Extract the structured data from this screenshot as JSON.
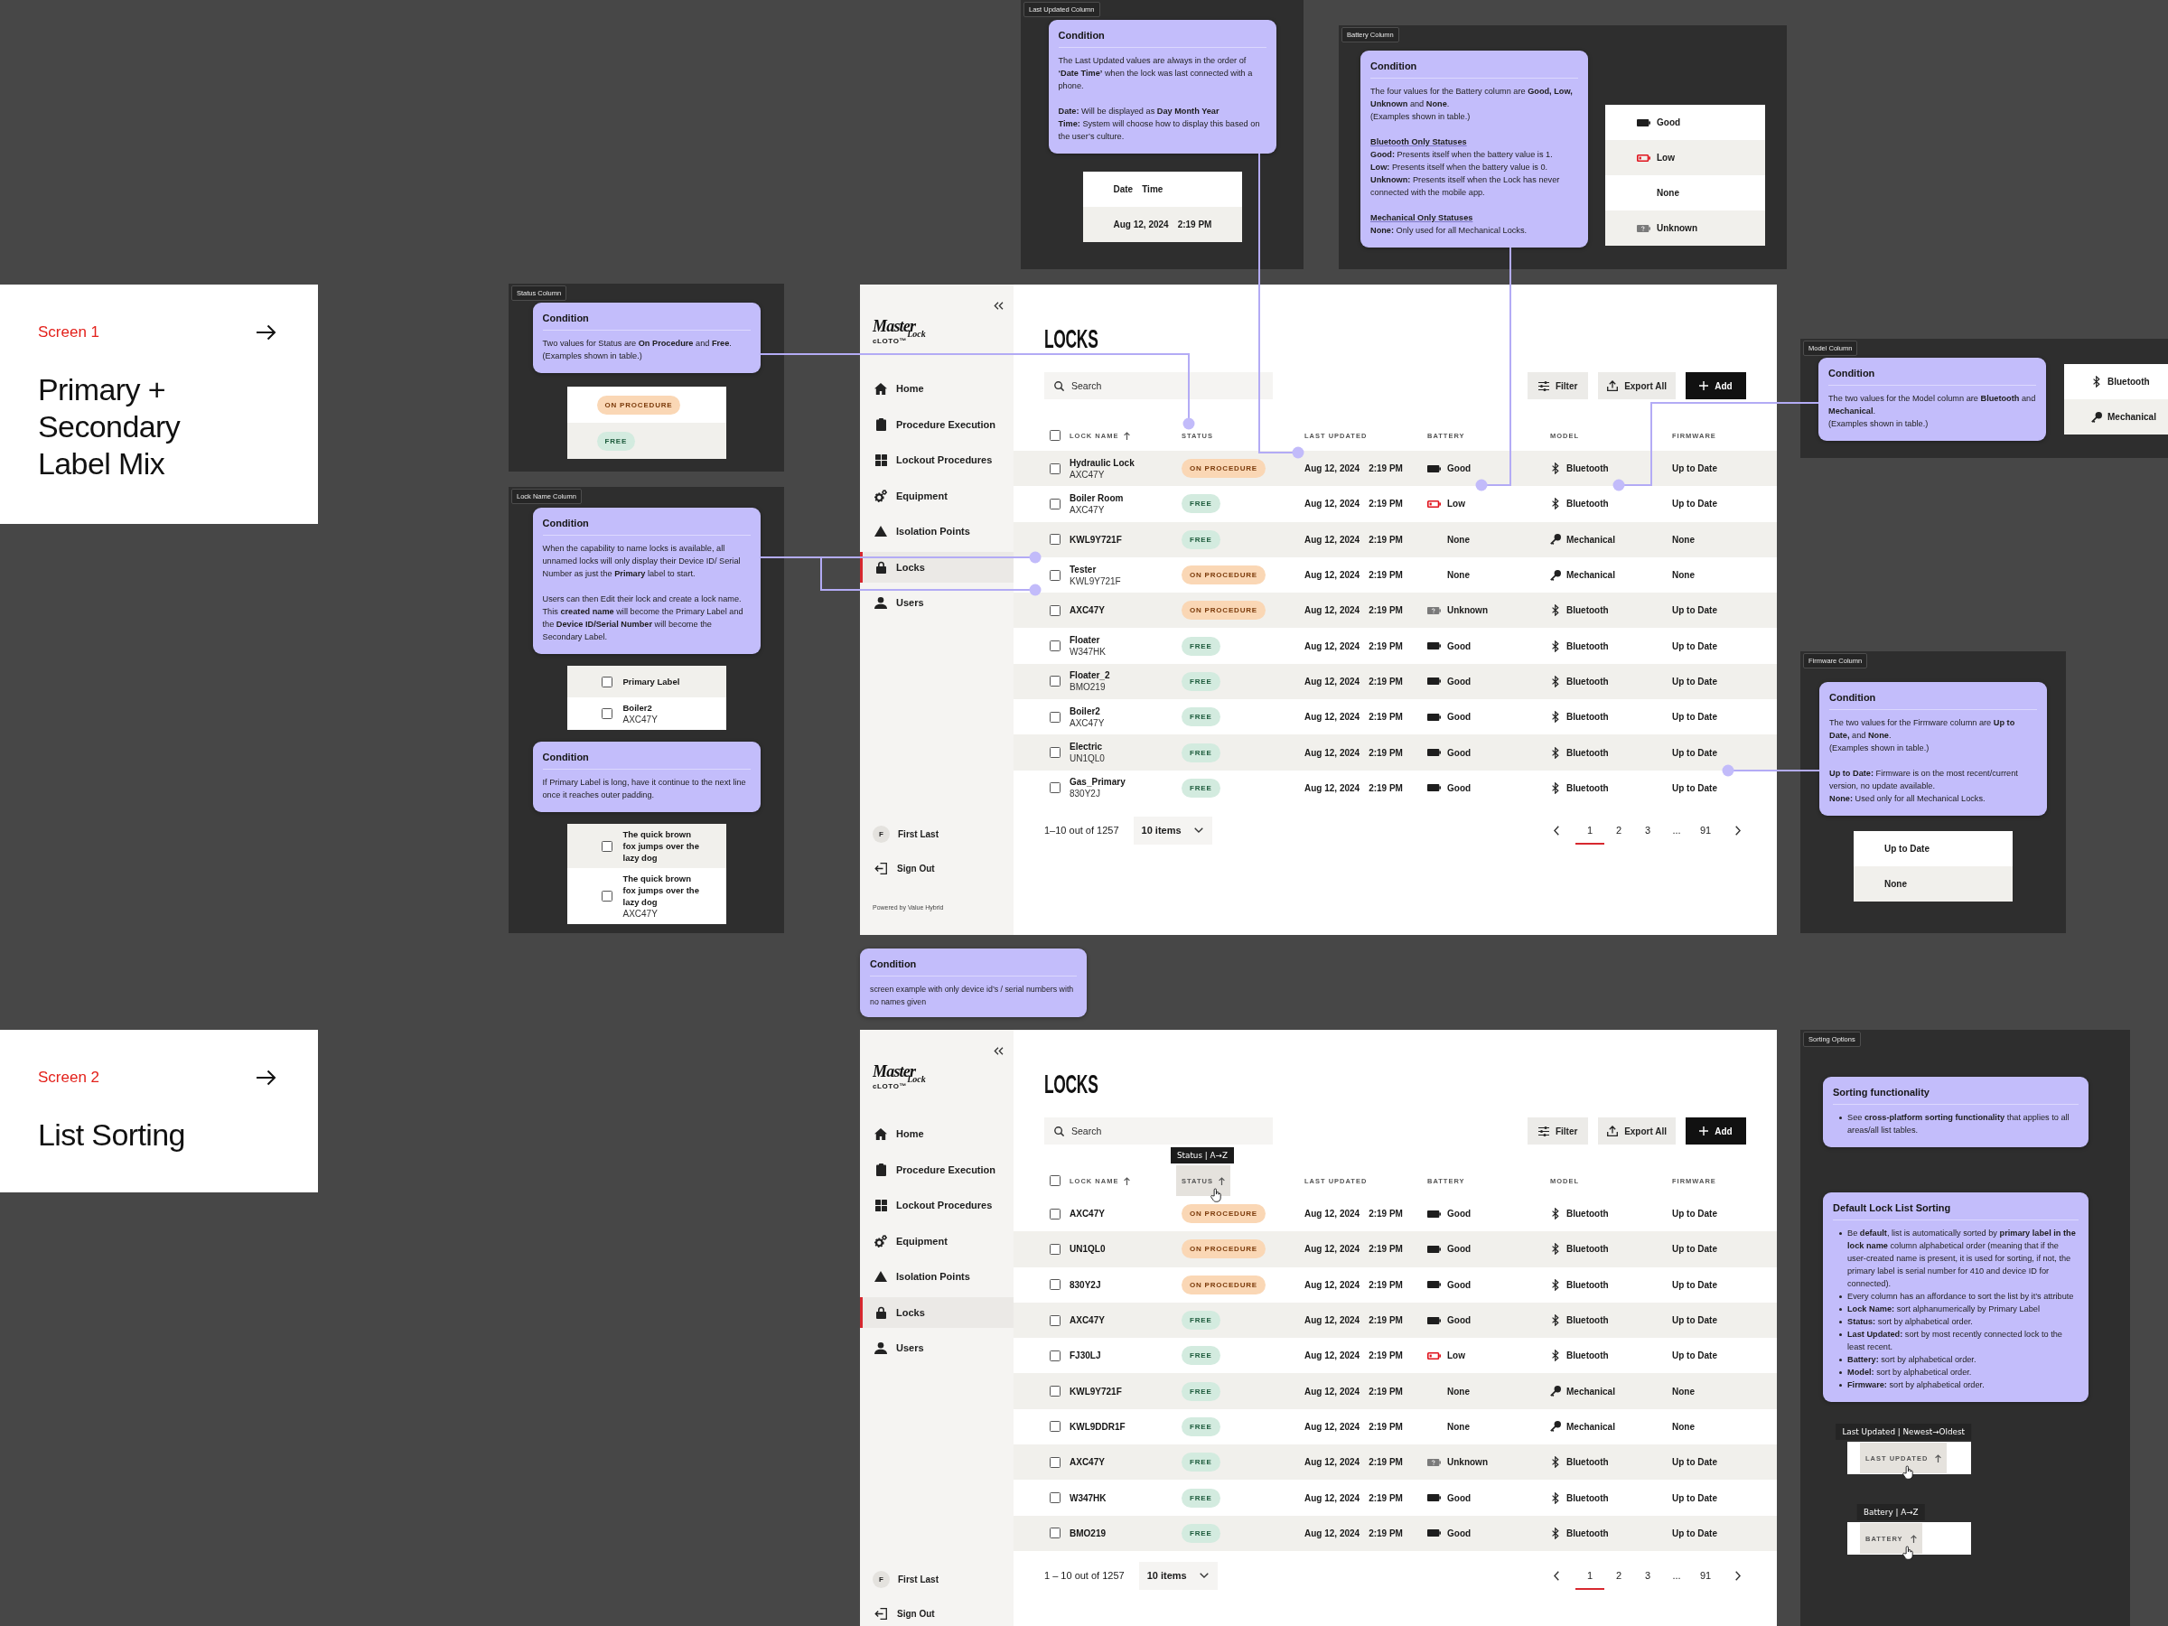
{
  "section_cards": [
    {
      "label": "Screen 1",
      "title": "Primary + Secondary Label Mix"
    },
    {
      "label": "Screen 2",
      "title": "List Sorting"
    }
  ],
  "annotation_panels": [
    {
      "tag": "Last Updated Column",
      "blocks": [
        {
          "kind": "condition",
          "title": "Condition",
          "paragraphs": [
            {
              "lines": [
                "The Last Updated values are always in the order of **‘Date Time’** when the lock was last connected with a phone."
              ]
            },
            {
              "lines": [
                "**Date:** Will be displayed as **Day Month Year**",
                "**Time:** System will choose how to display this based on the user’s culture."
              ]
            }
          ]
        },
        {
          "kind": "example",
          "rows": [
            {
              "kind": "datetime",
              "shaded": false,
              "date": "Date",
              "time": "Time"
            },
            {
              "kind": "datetime",
              "shaded": true,
              "date": "Aug 12, 2024",
              "time": "2:19 PM"
            }
          ]
        }
      ]
    },
    {
      "tag": "Battery Column",
      "blocks": [
        {
          "kind": "condition",
          "title": "Condition",
          "paragraphs": [
            {
              "lines": [
                "The four values for the Battery column are **Good, Low, Unknown** and **None**.",
                "(Examples shown in table.)"
              ]
            },
            {
              "heading": "Bluetooth Only Statuses",
              "lines": [
                "**Good:** Presents itself when the battery value is 1.",
                "**Low:** Presents itself when the battery value is 0.",
                "**Unknown:** Presents itself when the Lock has never connected with the mobile app."
              ]
            },
            {
              "heading": "Mechanical Only Statuses",
              "lines": [
                "**None:** Only used for all Mechanical Locks."
              ]
            }
          ]
        },
        {
          "kind": "example",
          "rows": [
            {
              "kind": "battery",
              "shaded": false,
              "battery": {
                "kind": "good",
                "label": "Good"
              }
            },
            {
              "kind": "battery",
              "shaded": true,
              "battery": {
                "kind": "low",
                "label": "Low"
              }
            },
            {
              "kind": "battery",
              "shaded": false,
              "battery": {
                "kind": "none",
                "label": "None"
              }
            },
            {
              "kind": "battery",
              "shaded": true,
              "battery": {
                "kind": "unknown",
                "label": "Unknown"
              }
            }
          ]
        }
      ]
    },
    {
      "tag": "Status Column",
      "blocks": [
        {
          "kind": "condition",
          "title": "Condition",
          "paragraphs": [
            {
              "lines": [
                "Two values for Status are **On Procedure** and **Free**.",
                "(Examples shown in table.)"
              ]
            }
          ]
        },
        {
          "kind": "example",
          "rows": [
            {
              "kind": "status",
              "shaded": false,
              "status": {
                "kind": "procedure",
                "label": "ON PROCEDURE"
              }
            },
            {
              "kind": "status",
              "shaded": true,
              "status": {
                "kind": "free",
                "label": "FREE"
              }
            }
          ]
        }
      ]
    },
    {
      "tag": "Model Column",
      "blocks": [
        {
          "kind": "condition",
          "title": "Condition",
          "paragraphs": [
            {
              "lines": [
                "The two values for the Model column are **Bluetooth** and **Mechanical**.",
                "(Examples shown in table.)"
              ]
            }
          ]
        },
        {
          "kind": "example",
          "rows": [
            {
              "kind": "model",
              "shaded": false,
              "model": {
                "kind": "bluetooth",
                "label": "Bluetooth"
              }
            },
            {
              "kind": "model",
              "shaded": true,
              "model": {
                "kind": "mechanical",
                "label": "Mechanical"
              }
            }
          ]
        }
      ]
    },
    {
      "tag": "Lock Name Column",
      "blocks": [
        {
          "kind": "condition",
          "title": "Condition",
          "paragraphs": [
            {
              "lines": [
                "When the capability to name locks is available, all unnamed locks will only display their Device ID/ Serial Number as just the **Primary** label to start."
              ]
            },
            {
              "lines": [
                "Users can then Edit their lock and create a lock name. This **created name** will become the Primary Label and the **Device ID/Serial Number** will become the Secondary Label."
              ]
            }
          ]
        },
        {
          "kind": "example",
          "rows": [
            {
              "kind": "lock",
              "shaded": true,
              "checked": false,
              "primary": "Primary Label"
            },
            {
              "kind": "lock",
              "shaded": false,
              "checked": false,
              "primary": "Boiler2",
              "secondary": "AXC47Y"
            }
          ]
        },
        {
          "kind": "condition",
          "title": "Condition",
          "paragraphs": [
            {
              "lines": [
                "If Primary Label is long, have it continue to the next line once it reaches outer padding."
              ]
            }
          ]
        },
        {
          "kind": "example",
          "rows": [
            {
              "kind": "lock",
              "shaded": true,
              "checked": false,
              "primary": "The quick brown fox jumps over the lazy dog"
            },
            {
              "kind": "lock",
              "shaded": false,
              "checked": false,
              "primary": "The quick brown fox jumps over the lazy dog",
              "secondary": "AXC47Y"
            }
          ]
        }
      ]
    },
    {
      "tag": "Firmware Column",
      "blocks": [
        {
          "kind": "condition",
          "title": "Condition",
          "paragraphs": [
            {
              "lines": [
                "The two values for the Firmware column are **Up to Date,** and **None**.",
                "(Examples shown in table.)"
              ]
            },
            {
              "lines": [
                "**Up to Date:** Firmware is on the most recent/current version, no update available.",
                "**None:** Used only for all Mechanical Locks."
              ]
            }
          ]
        },
        {
          "kind": "example",
          "rows": [
            {
              "kind": "text",
              "shaded": false,
              "label": "Up to Date"
            },
            {
              "kind": "text",
              "shaded": true,
              "label": "None"
            }
          ]
        }
      ]
    },
    {
      "tag": "Sorting Options",
      "blocks": [
        {
          "kind": "bullets",
          "title": "Sorting functionality",
          "items": [
            "See **cross-platform sorting functionality** that applies to all areas/all list tables."
          ]
        },
        {
          "kind": "bullets",
          "title": "Default Lock List Sorting",
          "items": [
            "Be **default**, list is automatically sorted by **primary label in the lock name** column alphabetical order (meaning that if the user-created name is present, it is used for sorting, if not, the primary label is serial number for 410 and device ID for connected).",
            "Every column has an affordance to sort the list by it’s attribute",
            "**Lock Name:** sort alphanumerically by Primary Label",
            "**Status:** sort by alphabetical order.",
            "**Last Updated:** sort by most recently connected lock to the least recent.",
            "**Battery:** sort by alphabetical order.",
            "**Model:** sort by alphabetical order.",
            "**Firmware:** sort by alphabetical order."
          ]
        },
        {
          "kind": "sort-example",
          "tooltip": "Last Updated | Newest→Oldest",
          "header": "LAST UPDATED"
        },
        {
          "kind": "sort-example",
          "tooltip": "Battery | A→Z",
          "header": "BATTERY"
        }
      ]
    }
  ],
  "screens": [
    {
      "sidebar": {
        "logo": {
          "wordmark": "Master",
          "sub": "Lock",
          "product": "cLOTO™"
        },
        "nav": [
          {
            "label": "Home",
            "selected": false
          },
          {
            "label": "Procedure Execution",
            "selected": false
          },
          {
            "label": "Lockout Procedures",
            "selected": false
          },
          {
            "label": "Equipment",
            "selected": false
          },
          {
            "label": "Isolation Points",
            "selected": false
          },
          {
            "label": "Locks",
            "selected": true
          },
          {
            "label": "Users",
            "selected": false
          }
        ],
        "user": {
          "initial": "F",
          "name": "First Last"
        },
        "sign_out": "Sign Out",
        "footer": "Powered by Value Hybrid"
      },
      "title": "LOCKS",
      "search": {
        "placeholder": "Search"
      },
      "actions": [
        {
          "label": "Filter",
          "kind": "secondary"
        },
        {
          "label": "Export All",
          "kind": "secondary"
        },
        {
          "label": "Add",
          "kind": "primary"
        }
      ],
      "table": {
        "select_all": {
          "checked": false
        },
        "columns": [
          {
            "label": "LOCK NAME",
            "sort_arrow": true,
            "hovered": false
          },
          {
            "label": "STATUS",
            "sort_arrow": false,
            "hovered": false
          },
          {
            "label": "LAST UPDATED",
            "sort_arrow": false,
            "hovered": false
          },
          {
            "label": "BATTERY",
            "sort_arrow": false,
            "hovered": false
          },
          {
            "label": "MODEL",
            "sort_arrow": false,
            "hovered": false
          },
          {
            "label": "FIRMWARE",
            "sort_arrow": false,
            "hovered": false
          }
        ],
        "rows": [
          {
            "shaded": true,
            "checked": false,
            "name": {
              "primary": "Hydraulic Lock",
              "secondary": "AXC47Y"
            },
            "status": {
              "kind": "procedure",
              "label": "ON PROCEDURE"
            },
            "date": "Aug 12, 2024",
            "time": "2:19 PM",
            "battery": {
              "kind": "good",
              "label": "Good"
            },
            "model": {
              "kind": "bluetooth",
              "label": "Bluetooth"
            },
            "firmware": "Up to Date"
          },
          {
            "shaded": false,
            "checked": false,
            "name": {
              "primary": "Boiler Room",
              "secondary": "AXC47Y"
            },
            "status": {
              "kind": "free",
              "label": "FREE"
            },
            "date": "Aug 12, 2024",
            "time": "2:19 PM",
            "battery": {
              "kind": "low",
              "label": "Low"
            },
            "model": {
              "kind": "bluetooth",
              "label": "Bluetooth"
            },
            "firmware": "Up to Date"
          },
          {
            "shaded": true,
            "checked": false,
            "name": {
              "primary": "KWL9Y721F"
            },
            "status": {
              "kind": "free",
              "label": "FREE"
            },
            "date": "Aug 12, 2024",
            "time": "2:19 PM",
            "battery": {
              "kind": "none",
              "label": "None"
            },
            "model": {
              "kind": "mechanical",
              "label": "Mechanical"
            },
            "firmware": "None"
          },
          {
            "shaded": false,
            "checked": false,
            "name": {
              "primary": "Tester",
              "secondary": "KWL9Y721F"
            },
            "status": {
              "kind": "procedure",
              "label": "ON PROCEDURE"
            },
            "date": "Aug 12, 2024",
            "time": "2:19 PM",
            "battery": {
              "kind": "none",
              "label": "None"
            },
            "model": {
              "kind": "mechanical",
              "label": "Mechanical"
            },
            "firmware": "None"
          },
          {
            "shaded": true,
            "checked": false,
            "name": {
              "primary": "AXC47Y"
            },
            "status": {
              "kind": "procedure",
              "label": "ON PROCEDURE"
            },
            "date": "Aug 12, 2024",
            "time": "2:19 PM",
            "battery": {
              "kind": "unknown",
              "label": "Unknown"
            },
            "model": {
              "kind": "bluetooth",
              "label": "Bluetooth"
            },
            "firmware": "Up to Date"
          },
          {
            "shaded": false,
            "checked": false,
            "name": {
              "primary": "Floater",
              "secondary": "W347HK"
            },
            "status": {
              "kind": "free",
              "label": "FREE"
            },
            "date": "Aug 12, 2024",
            "time": "2:19 PM",
            "battery": {
              "kind": "good",
              "label": "Good"
            },
            "model": {
              "kind": "bluetooth",
              "label": "Bluetooth"
            },
            "firmware": "Up to Date"
          },
          {
            "shaded": true,
            "checked": false,
            "name": {
              "primary": "Floater_2",
              "secondary": "BMO219"
            },
            "status": {
              "kind": "free",
              "label": "FREE"
            },
            "date": "Aug 12, 2024",
            "time": "2:19 PM",
            "battery": {
              "kind": "good",
              "label": "Good"
            },
            "model": {
              "kind": "bluetooth",
              "label": "Bluetooth"
            },
            "firmware": "Up to Date"
          },
          {
            "shaded": false,
            "checked": false,
            "name": {
              "primary": "Boiler2",
              "secondary": "AXC47Y"
            },
            "status": {
              "kind": "free",
              "label": "FREE"
            },
            "date": "Aug 12, 2024",
            "time": "2:19 PM",
            "battery": {
              "kind": "good",
              "label": "Good"
            },
            "model": {
              "kind": "bluetooth",
              "label": "Bluetooth"
            },
            "firmware": "Up to Date"
          },
          {
            "shaded": true,
            "checked": false,
            "name": {
              "primary": "Electric",
              "secondary": "UN1QL0"
            },
            "status": {
              "kind": "free",
              "label": "FREE"
            },
            "date": "Aug 12, 2024",
            "time": "2:19 PM",
            "battery": {
              "kind": "good",
              "label": "Good"
            },
            "model": {
              "kind": "bluetooth",
              "label": "Bluetooth"
            },
            "firmware": "Up to Date"
          },
          {
            "shaded": false,
            "checked": false,
            "name": {
              "primary": "Gas_Primary",
              "secondary": "830Y2J"
            },
            "status": {
              "kind": "free",
              "label": "FREE"
            },
            "date": "Aug 12, 2024",
            "time": "2:19 PM",
            "battery": {
              "kind": "good",
              "label": "Good"
            },
            "model": {
              "kind": "bluetooth",
              "label": "Bluetooth"
            },
            "firmware": "Up to Date"
          }
        ]
      },
      "pagination": {
        "summary": "1–10 out of 1257",
        "page_size": "10 items",
        "pages": [
          {
            "label": "1",
            "selected": true
          },
          {
            "label": "2",
            "selected": false
          },
          {
            "label": "3",
            "selected": false
          },
          {
            "label": "...",
            "selected": false
          },
          {
            "label": "91",
            "selected": false
          }
        ]
      }
    },
    {
      "sidebar": {
        "logo": {
          "wordmark": "Master",
          "sub": "Lock",
          "product": "cLOTO™"
        },
        "nav": [
          {
            "label": "Home",
            "selected": false
          },
          {
            "label": "Procedure Execution",
            "selected": false
          },
          {
            "label": "Lockout Procedures",
            "selected": false
          },
          {
            "label": "Equipment",
            "selected": false
          },
          {
            "label": "Isolation Points",
            "selected": false
          },
          {
            "label": "Locks",
            "selected": true
          },
          {
            "label": "Users",
            "selected": false
          }
        ],
        "user": {
          "initial": "F",
          "name": "First Last"
        },
        "sign_out": "Sign Out"
      },
      "title": "LOCKS",
      "search": {
        "placeholder": "Search"
      },
      "actions": [
        {
          "label": "Filter",
          "kind": "secondary"
        },
        {
          "label": "Export All",
          "kind": "secondary"
        },
        {
          "label": "Add",
          "kind": "primary"
        }
      ],
      "table": {
        "select_all": {
          "checked": false
        },
        "columns": [
          {
            "label": "LOCK NAME",
            "sort_arrow": true,
            "hovered": false
          },
          {
            "label": "STATUS",
            "sort_arrow": true,
            "hovered": true,
            "tooltip": "Status | A→Z"
          },
          {
            "label": "LAST UPDATED",
            "sort_arrow": false,
            "hovered": false
          },
          {
            "label": "BATTERY",
            "sort_arrow": false,
            "hovered": false
          },
          {
            "label": "MODEL",
            "sort_arrow": false,
            "hovered": false
          },
          {
            "label": "FIRMWARE",
            "sort_arrow": false,
            "hovered": false
          }
        ],
        "rows": [
          {
            "shaded": false,
            "checked": false,
            "name": {
              "primary": "AXC47Y"
            },
            "status": {
              "kind": "procedure",
              "label": "ON PROCEDURE"
            },
            "date": "Aug 12, 2024",
            "time": "2:19 PM",
            "battery": {
              "kind": "good",
              "label": "Good"
            },
            "model": {
              "kind": "bluetooth",
              "label": "Bluetooth"
            },
            "firmware": "Up to Date"
          },
          {
            "shaded": true,
            "checked": false,
            "name": {
              "primary": "UN1QL0"
            },
            "status": {
              "kind": "procedure",
              "label": "ON PROCEDURE"
            },
            "date": "Aug 12, 2024",
            "time": "2:19 PM",
            "battery": {
              "kind": "good",
              "label": "Good"
            },
            "model": {
              "kind": "bluetooth",
              "label": "Bluetooth"
            },
            "firmware": "Up to Date"
          },
          {
            "shaded": false,
            "checked": false,
            "name": {
              "primary": "830Y2J"
            },
            "status": {
              "kind": "procedure",
              "label": "ON PROCEDURE"
            },
            "date": "Aug 12, 2024",
            "time": "2:19 PM",
            "battery": {
              "kind": "good",
              "label": "Good"
            },
            "model": {
              "kind": "bluetooth",
              "label": "Bluetooth"
            },
            "firmware": "Up to Date"
          },
          {
            "shaded": true,
            "checked": false,
            "name": {
              "primary": "AXC47Y"
            },
            "status": {
              "kind": "free",
              "label": "FREE"
            },
            "date": "Aug 12, 2024",
            "time": "2:19 PM",
            "battery": {
              "kind": "good",
              "label": "Good"
            },
            "model": {
              "kind": "bluetooth",
              "label": "Bluetooth"
            },
            "firmware": "Up to Date"
          },
          {
            "shaded": false,
            "checked": false,
            "name": {
              "primary": "FJ30LJ"
            },
            "status": {
              "kind": "free",
              "label": "FREE"
            },
            "date": "Aug 12, 2024",
            "time": "2:19 PM",
            "battery": {
              "kind": "low",
              "label": "Low"
            },
            "model": {
              "kind": "bluetooth",
              "label": "Bluetooth"
            },
            "firmware": "Up to Date"
          },
          {
            "shaded": true,
            "checked": false,
            "name": {
              "primary": "KWL9Y721F"
            },
            "status": {
              "kind": "free",
              "label": "FREE"
            },
            "date": "Aug 12, 2024",
            "time": "2:19 PM",
            "battery": {
              "kind": "none",
              "label": "None"
            },
            "model": {
              "kind": "mechanical",
              "label": "Mechanical"
            },
            "firmware": "None"
          },
          {
            "shaded": false,
            "checked": false,
            "name": {
              "primary": "KWL9DDR1F"
            },
            "status": {
              "kind": "free",
              "label": "FREE"
            },
            "date": "Aug 12, 2024",
            "time": "2:19 PM",
            "battery": {
              "kind": "none",
              "label": "None"
            },
            "model": {
              "kind": "mechanical",
              "label": "Mechanical"
            },
            "firmware": "None"
          },
          {
            "shaded": true,
            "checked": false,
            "name": {
              "primary": "AXC47Y"
            },
            "status": {
              "kind": "free",
              "label": "FREE"
            },
            "date": "Aug 12, 2024",
            "time": "2:19 PM",
            "battery": {
              "kind": "unknown",
              "label": "Unknown"
            },
            "model": {
              "kind": "bluetooth",
              "label": "Bluetooth"
            },
            "firmware": "Up to Date"
          },
          {
            "shaded": false,
            "checked": false,
            "name": {
              "primary": "W347HK"
            },
            "status": {
              "kind": "free",
              "label": "FREE"
            },
            "date": "Aug 12, 2024",
            "time": "2:19 PM",
            "battery": {
              "kind": "good",
              "label": "Good"
            },
            "model": {
              "kind": "bluetooth",
              "label": "Bluetooth"
            },
            "firmware": "Up to Date"
          },
          {
            "shaded": true,
            "checked": false,
            "name": {
              "primary": "BMO219"
            },
            "status": {
              "kind": "free",
              "label": "FREE"
            },
            "date": "Aug 12, 2024",
            "time": "2:19 PM",
            "battery": {
              "kind": "good",
              "label": "Good"
            },
            "model": {
              "kind": "bluetooth",
              "label": "Bluetooth"
            },
            "firmware": "Up to Date"
          }
        ]
      },
      "pagination": {
        "summary": "1 – 10 out of 1257",
        "page_size": "10 items",
        "pages": [
          {
            "label": "1",
            "selected": true
          },
          {
            "label": "2",
            "selected": false
          },
          {
            "label": "3",
            "selected": false
          },
          {
            "label": "...",
            "selected": false
          },
          {
            "label": "91",
            "selected": false
          }
        ]
      }
    }
  ],
  "notes": [
    {
      "title": "Condition",
      "text": "screen example with only device id’s / serial numbers with no names given"
    }
  ]
}
